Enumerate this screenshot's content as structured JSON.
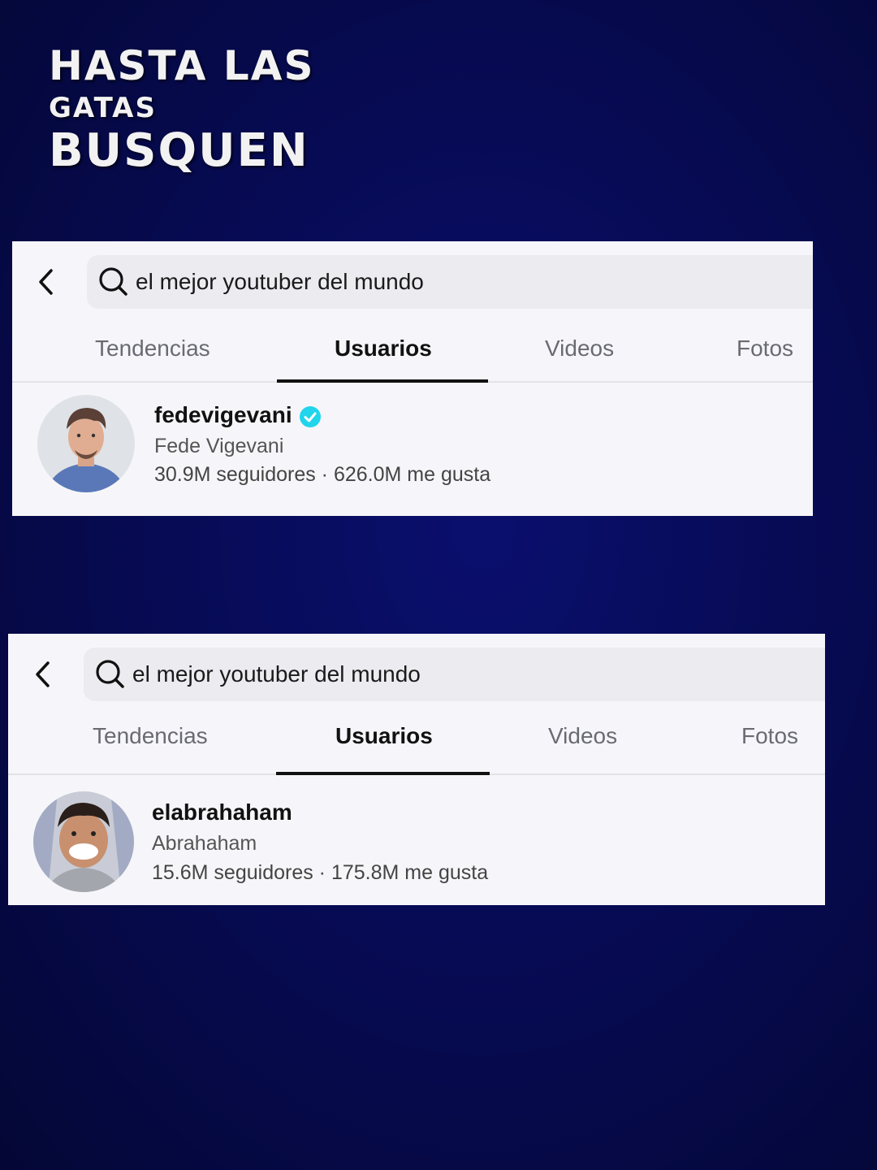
{
  "overlay": {
    "line1": "HASTA LAS",
    "line2": "GATAS",
    "line3": "BUSQUEN"
  },
  "colors": {
    "background": "#070b55",
    "verified": "#20d5ec",
    "panel": "#f6f6fa"
  },
  "results": [
    {
      "search_query": "el mejor youtuber del mundo",
      "tabs": [
        "Tendencias",
        "Usuarios",
        "Videos",
        "Fotos"
      ],
      "active_tab": "Usuarios",
      "user": {
        "username": "fedevigevani",
        "verified": true,
        "display_name": "Fede Vigevani",
        "stats": "30.9M seguidores · 626.0M me gusta"
      }
    },
    {
      "search_query": "el mejor youtuber del mundo",
      "tabs": [
        "Tendencias",
        "Usuarios",
        "Videos",
        "Fotos"
      ],
      "active_tab": "Usuarios",
      "user": {
        "username": "elabrahaham",
        "verified": false,
        "display_name": "Abrahaham",
        "stats": "15.6M seguidores · 175.8M me gusta"
      }
    }
  ]
}
